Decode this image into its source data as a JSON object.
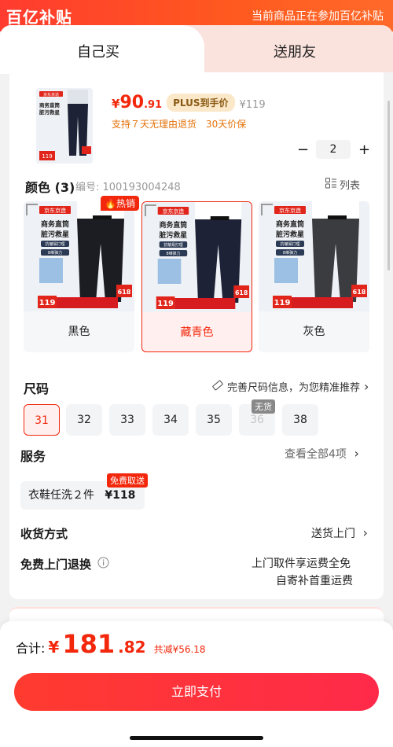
{
  "banner": {
    "logo": "百亿补贴",
    "notice": "当前商品正在参加百亿补贴"
  },
  "tabs": [
    {
      "label": "自己买",
      "active": true
    },
    {
      "label": "送朋友",
      "active": false
    }
  ],
  "product": {
    "thumb_brand": "京东京造",
    "thumb_text": [
      "商务直筒",
      "脏污救星"
    ],
    "price_symbol": "¥",
    "price_int": "90",
    "price_dec": ".91",
    "plus_tag": "PLUS到手价",
    "original_price": "¥119",
    "guarantee": "支持７天无理由退货　30天价保",
    "quantity": "2",
    "minus": "−",
    "plus": "+"
  },
  "color": {
    "title": "颜色 (3)",
    "code": "编号: 100193004248",
    "list_toggle": "列表",
    "hot_tag": "热销",
    "options": [
      {
        "name": "黑色",
        "selected": false,
        "swatch": "#1c1d22"
      },
      {
        "name": "藏青色",
        "selected": true,
        "swatch": "#1d2236"
      },
      {
        "name": "灰色",
        "selected": false,
        "swatch": "#3a3c40"
      }
    ],
    "card_brand": "京东京造",
    "card_lines": [
      "商务直筒",
      "脏污救星"
    ],
    "card_badges": [
      "抗皱易打理",
      "8维弹力"
    ],
    "card_price": "119",
    "card_tag": "618"
  },
  "size": {
    "title": "尺码",
    "tip": "完善尺码信息，为您精准推荐",
    "options": [
      {
        "label": "31",
        "state": "selected"
      },
      {
        "label": "32",
        "state": "normal"
      },
      {
        "label": "33",
        "state": "normal"
      },
      {
        "label": "34",
        "state": "normal"
      },
      {
        "label": "35",
        "state": "normal"
      },
      {
        "label": "36",
        "state": "disabled"
      },
      {
        "label": "38",
        "state": "normal"
      }
    ],
    "nostock_tag": "无货"
  },
  "service": {
    "title": "服务",
    "view_all": "查看全部4项",
    "chip_name": "衣鞋任洗２件",
    "chip_price": "¥118",
    "free_tag": "免费取送"
  },
  "delivery": {
    "title": "收货方式",
    "value": "送货上门"
  },
  "returns": {
    "title": "免费上门退换",
    "line1": "上门取件享运费全免",
    "line2": "自寄补首重运费"
  },
  "checkout": {
    "total_label": "合计:",
    "currency": "¥",
    "total_int": "181",
    "total_dec": ".82",
    "saving": "共减¥56.18",
    "pay_button": "立即支付"
  },
  "colors": {
    "accent": "#f2270c",
    "plus_bg": "#fbe8c8",
    "guarantee": "#e4720a"
  }
}
